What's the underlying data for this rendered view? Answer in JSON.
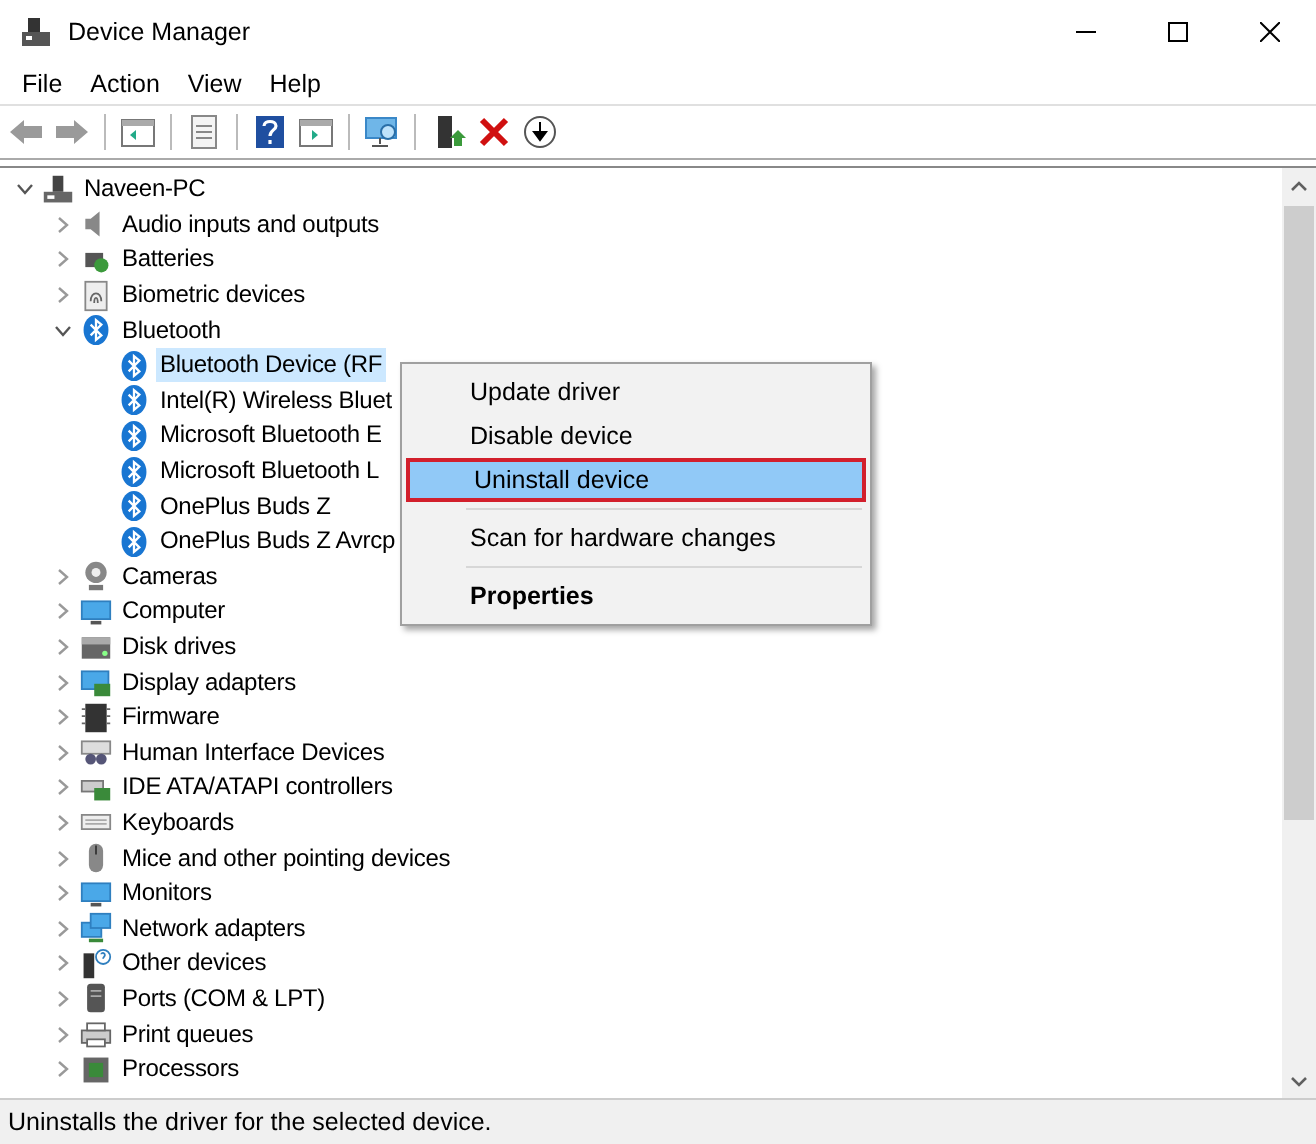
{
  "window": {
    "title": "Device Manager"
  },
  "menu_bar": [
    "File",
    "Action",
    "View",
    "Help"
  ],
  "tree": [
    {
      "label": "Naveen-PC",
      "expanded": true,
      "selected": false,
      "children": [
        {
          "label": "Audio inputs and outputs",
          "expanded": false,
          "selected": false
        },
        {
          "label": "Batteries",
          "expanded": false,
          "selected": false
        },
        {
          "label": "Biometric devices",
          "expanded": false,
          "selected": false
        },
        {
          "label": "Bluetooth",
          "expanded": true,
          "selected": false,
          "children": [
            {
              "label": "Bluetooth Device (RF",
              "selected": true
            },
            {
              "label": "Intel(R) Wireless Bluet",
              "selected": false
            },
            {
              "label": "Microsoft Bluetooth E",
              "selected": false
            },
            {
              "label": "Microsoft Bluetooth L",
              "selected": false
            },
            {
              "label": "OnePlus Buds Z",
              "selected": false
            },
            {
              "label": "OnePlus Buds Z Avrcp",
              "selected": false
            }
          ]
        },
        {
          "label": "Cameras",
          "expanded": false,
          "selected": false
        },
        {
          "label": "Computer",
          "expanded": false,
          "selected": false
        },
        {
          "label": "Disk drives",
          "expanded": false,
          "selected": false
        },
        {
          "label": "Display adapters",
          "expanded": false,
          "selected": false
        },
        {
          "label": "Firmware",
          "expanded": false,
          "selected": false
        },
        {
          "label": "Human Interface Devices",
          "expanded": false,
          "selected": false
        },
        {
          "label": "IDE ATA/ATAPI controllers",
          "expanded": false,
          "selected": false
        },
        {
          "label": "Keyboards",
          "expanded": false,
          "selected": false
        },
        {
          "label": "Mice and other pointing devices",
          "expanded": false,
          "selected": false
        },
        {
          "label": "Monitors",
          "expanded": false,
          "selected": false
        },
        {
          "label": "Network adapters",
          "expanded": false,
          "selected": false
        },
        {
          "label": "Other devices",
          "expanded": false,
          "selected": false
        },
        {
          "label": "Ports (COM & LPT)",
          "expanded": false,
          "selected": false
        },
        {
          "label": "Print queues",
          "expanded": false,
          "selected": false
        },
        {
          "label": "Processors",
          "expanded": false,
          "selected": false
        }
      ]
    }
  ],
  "context_menu": [
    {
      "kind": "item",
      "label": "Update driver",
      "selected": false
    },
    {
      "kind": "item",
      "label": "Disable device",
      "selected": false
    },
    {
      "kind": "item",
      "label": "Uninstall device",
      "selected": true
    },
    {
      "kind": "separator"
    },
    {
      "kind": "item",
      "label": "Scan for hardware changes",
      "selected": false
    },
    {
      "kind": "separator"
    },
    {
      "kind": "default",
      "label": "Properties",
      "selected": false
    }
  ],
  "status_bar": "Uninstalls the driver for the selected device."
}
